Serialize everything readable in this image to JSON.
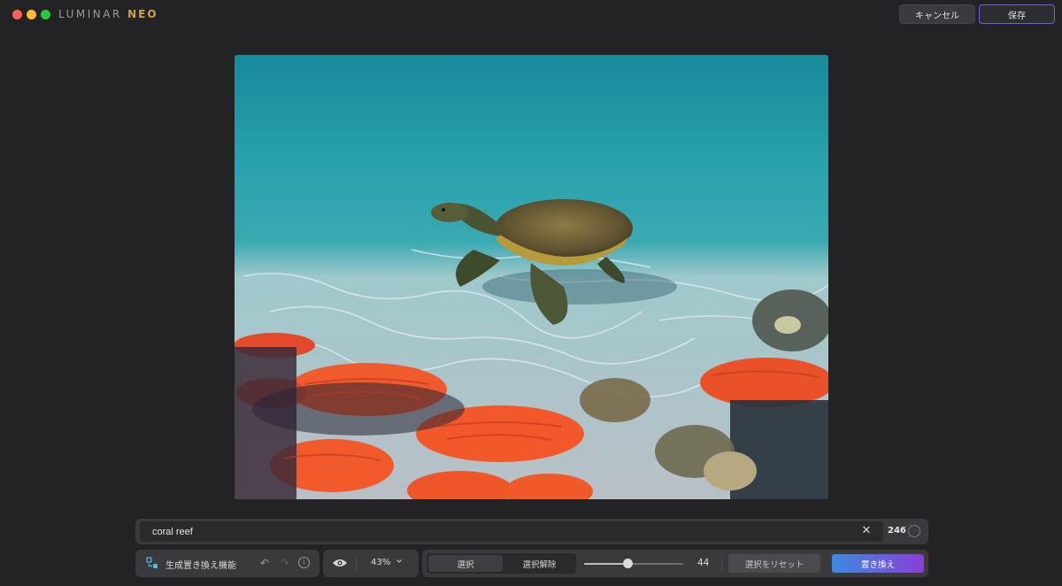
{
  "app": {
    "logo_main": "LUMINAR",
    "logo_accent": "NEO"
  },
  "header": {
    "cancel_label": "キャンセル",
    "save_label": "保存"
  },
  "image": {
    "subject": "sea-turtle-over-coral-reef"
  },
  "prompt": {
    "value": "coral reef",
    "count": "246"
  },
  "toolbar": {
    "feature_label": "生成置き換え機能",
    "zoom_label": "43%",
    "select_label": "選択",
    "deselect_label": "選択解除",
    "brush_size": "44",
    "brush_size_fraction": 0.44,
    "reset_selection_label": "選択をリセット",
    "replace_label": "置き換え"
  },
  "colors": {
    "accent_save_border": "#6a63d8",
    "replace_gradient_start": "#3b8be2",
    "replace_gradient_end": "#8a3ed8"
  }
}
